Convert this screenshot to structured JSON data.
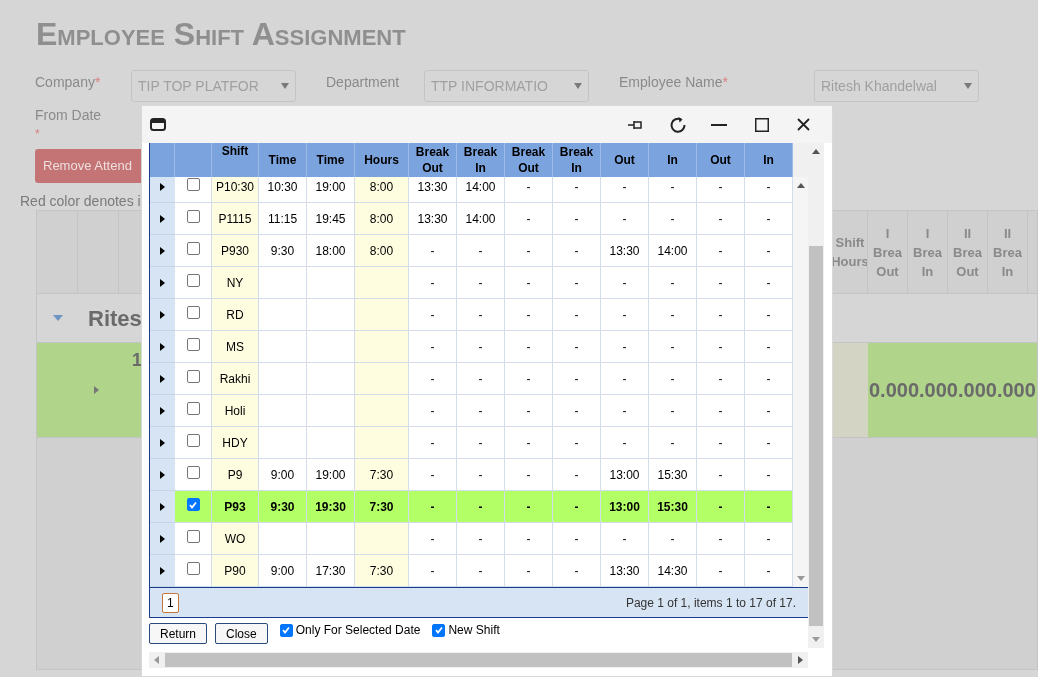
{
  "page": {
    "title": "Employee Shift Assignment",
    "filters": [
      {
        "label": "Company",
        "required_mark": "*",
        "value": "TIP TOP PLATFOR"
      },
      {
        "label": "Department",
        "value": "TTP INFORMATIO"
      },
      {
        "label": "Employee Name",
        "required_mark": "*",
        "value": "Ritesh Khandelwal"
      }
    ],
    "from_date": {
      "label": "From Date",
      "required_mark": "*"
    },
    "remove_button": "Remove Attend",
    "note": "Red color denotes i"
  },
  "background_grid": {
    "columns": [
      [
        "Shift",
        "Hours"
      ],
      [
        "I",
        "Brea",
        "Out"
      ],
      [
        "I",
        "Brea",
        "In"
      ],
      [
        "II",
        "Brea",
        "Out"
      ],
      [
        "II",
        "Brea",
        "In"
      ]
    ],
    "group": {
      "label": "Rites",
      "expanded": true
    },
    "row": {
      "number": "1",
      "values": "0.000.000.000.000"
    }
  },
  "dialog": {
    "columns": [
      [
        "Shift"
      ],
      [
        "Time"
      ],
      [
        "Time"
      ],
      [
        "Hours"
      ],
      [
        "Break",
        "Out"
      ],
      [
        "Break",
        "In"
      ],
      [
        "Break",
        "Out"
      ],
      [
        "Break",
        "In"
      ],
      [
        "Out"
      ],
      [
        "In"
      ],
      [
        "Out"
      ],
      [
        "In"
      ]
    ],
    "rows": [
      {
        "shift": "P10:30",
        "time_in": "10:30",
        "time_out": "19:00",
        "hours": "8:00",
        "breaks": [
          "13:30",
          "14:00",
          "-",
          "-",
          "-",
          "-",
          "-",
          "-"
        ],
        "selected": false
      },
      {
        "shift": "P1115",
        "time_in": "11:15",
        "time_out": "19:45",
        "hours": "8:00",
        "breaks": [
          "13:30",
          "14:00",
          "-",
          "-",
          "-",
          "-",
          "-",
          "-"
        ],
        "selected": false
      },
      {
        "shift": "P930",
        "time_in": "9:30",
        "time_out": "18:00",
        "hours": "8:00",
        "breaks": [
          "-",
          "-",
          "-",
          "-",
          "13:30",
          "14:00",
          "-",
          "-"
        ],
        "selected": false
      },
      {
        "shift": "NY",
        "breaks": [
          "-",
          "-",
          "-",
          "-",
          "-",
          "-",
          "-",
          "-"
        ],
        "selected": false
      },
      {
        "shift": "RD",
        "breaks": [
          "-",
          "-",
          "-",
          "-",
          "-",
          "-",
          "-",
          "-"
        ],
        "selected": false
      },
      {
        "shift": "MS",
        "breaks": [
          "-",
          "-",
          "-",
          "-",
          "-",
          "-",
          "-",
          "-"
        ],
        "selected": false
      },
      {
        "shift": "Rakhi",
        "breaks": [
          "-",
          "-",
          "-",
          "-",
          "-",
          "-",
          "-",
          "-"
        ],
        "selected": false
      },
      {
        "shift": "Holi",
        "breaks": [
          "-",
          "-",
          "-",
          "-",
          "-",
          "-",
          "-",
          "-"
        ],
        "selected": false
      },
      {
        "shift": "HDY",
        "breaks": [
          "-",
          "-",
          "-",
          "-",
          "-",
          "-",
          "-",
          "-"
        ],
        "selected": false
      },
      {
        "shift": "P9",
        "time_in": "9:00",
        "time_out": "19:00",
        "hours": "7:30",
        "breaks": [
          "-",
          "-",
          "-",
          "-",
          "13:00",
          "15:30",
          "-",
          "-"
        ],
        "selected": false
      },
      {
        "shift": "P93",
        "time_in": "9:30",
        "time_out": "19:30",
        "hours": "7:30",
        "breaks": [
          "-",
          "-",
          "-",
          "-",
          "13:00",
          "15:30",
          "-",
          "-"
        ],
        "selected": true
      },
      {
        "shift": "WO",
        "breaks": [
          "-",
          "-",
          "-",
          "-",
          "-",
          "-",
          "-",
          "-"
        ],
        "selected": false
      },
      {
        "shift": "P90",
        "time_in": "9:00",
        "time_out": "17:30",
        "hours": "7:30",
        "breaks": [
          "-",
          "-",
          "-",
          "-",
          "13:30",
          "14:30",
          "-",
          "-"
        ],
        "selected": false
      }
    ],
    "pager": {
      "pages": [
        {
          "label": "1",
          "selected": true
        }
      ],
      "info": "Page 1 of 1, items 1 to 17 of 17."
    },
    "buttons": [
      "Return",
      "Close"
    ],
    "options": [
      {
        "label": "Only For Selected Date",
        "checked": true
      },
      {
        "label": "New Shift",
        "checked": true
      }
    ]
  }
}
